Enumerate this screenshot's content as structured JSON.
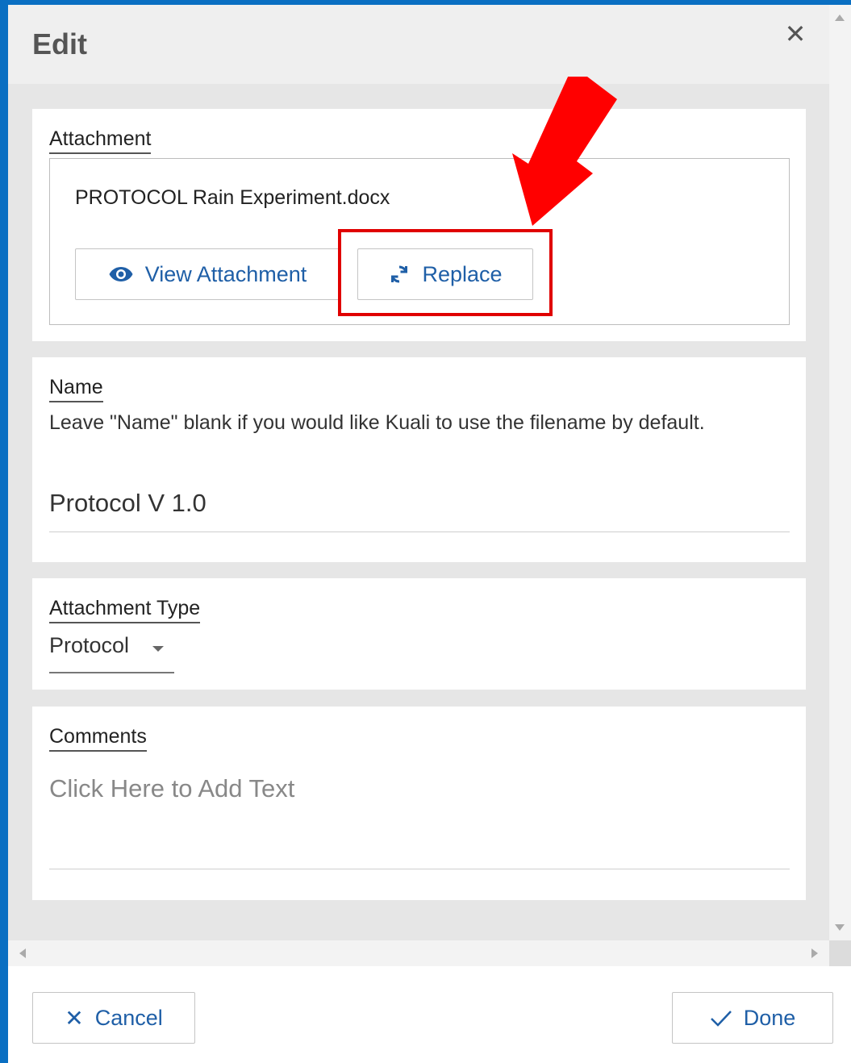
{
  "dialog": {
    "title": "Edit"
  },
  "attachment": {
    "label": "Attachment",
    "filename": "PROTOCOL Rain Experiment.docx",
    "view_button": "View Attachment",
    "replace_button": "Replace"
  },
  "name": {
    "label": "Name",
    "help": "Leave \"Name\" blank if you would like Kuali to use the filename by default.",
    "value": "Protocol V 1.0"
  },
  "attachment_type": {
    "label": "Attachment Type",
    "selected": "Protocol"
  },
  "comments": {
    "label": "Comments",
    "placeholder": "Click Here to Add Text"
  },
  "footer": {
    "cancel_label": "Cancel",
    "done_label": "Done"
  },
  "colors": {
    "accent": "#1f5fa7",
    "frame_border": "#0a6fc2",
    "annotation": "#e00000"
  }
}
